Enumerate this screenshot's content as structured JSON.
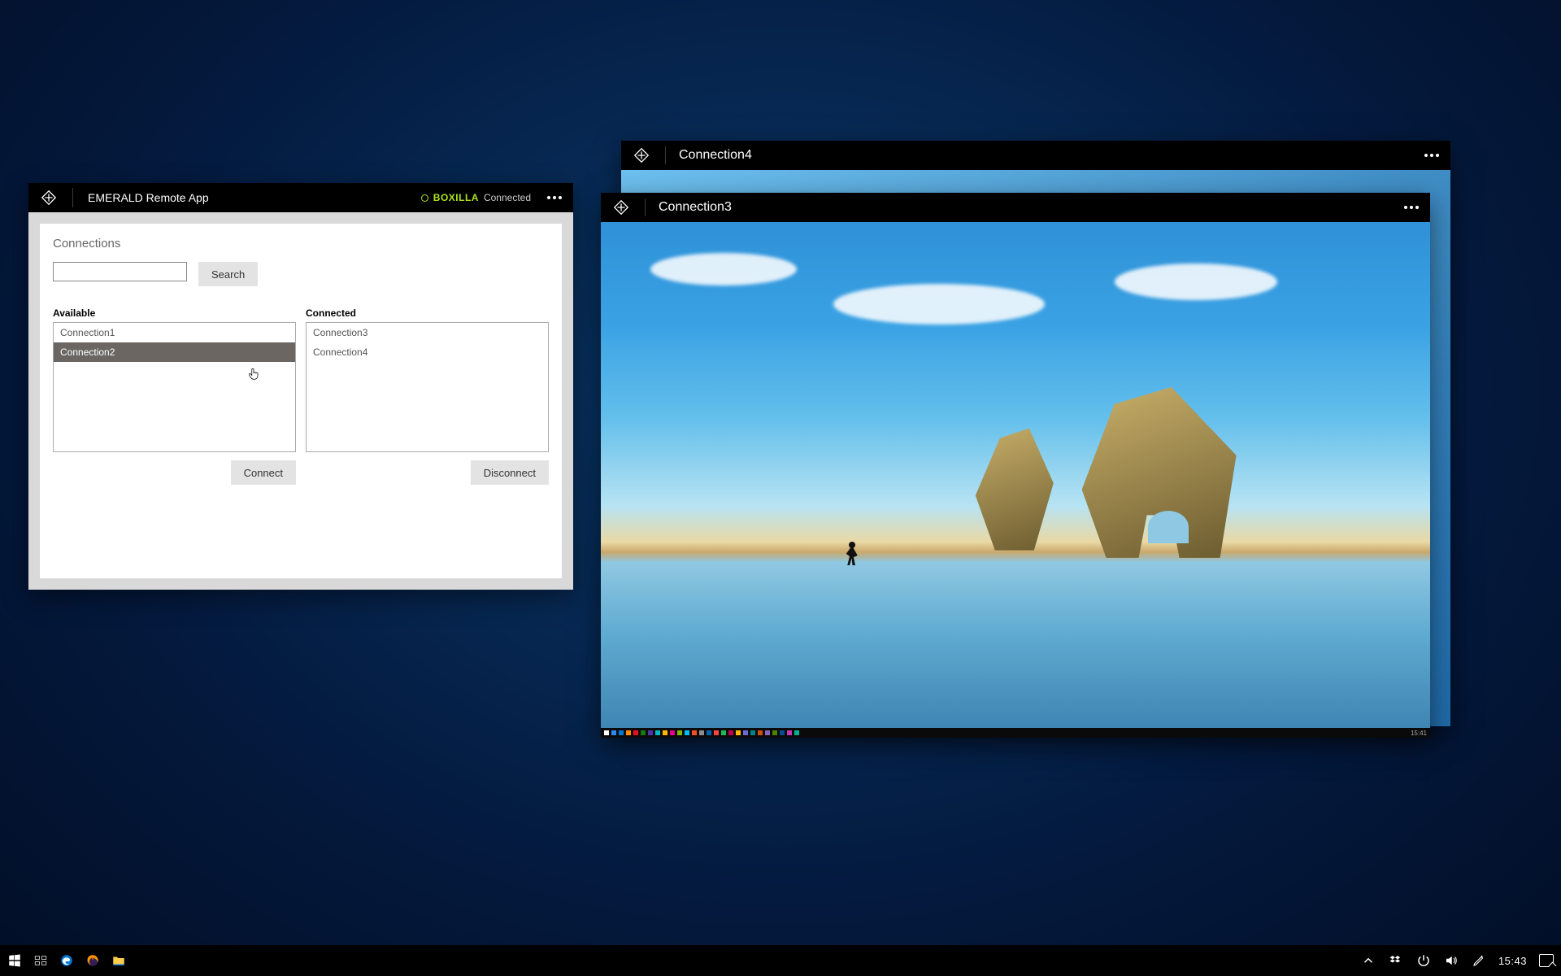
{
  "emerald": {
    "title": "EMERALD Remote App",
    "status_brand": "BOXILLA",
    "status_text": "Connected",
    "section": "Connections",
    "search_btn": "Search",
    "available_label": "Available",
    "connected_label": "Connected",
    "available": [
      "Connection1",
      "Connection2"
    ],
    "available_selected_index": 1,
    "connected": [
      "Connection3",
      "Connection4"
    ],
    "connect_btn": "Connect",
    "disconnect_btn": "Disconnect"
  },
  "remote3": {
    "title": "Connection3",
    "inner_clock": "15:41"
  },
  "remote4": {
    "title": "Connection4"
  },
  "taskbar": {
    "clock": "15:43",
    "tray_icons": [
      "chevron-up",
      "dropbox",
      "power",
      "volume",
      "pen"
    ],
    "pinned": [
      "start",
      "task-view",
      "edge",
      "firefox",
      "file-explorer"
    ]
  },
  "colors": {
    "accent": "#aee31a"
  }
}
